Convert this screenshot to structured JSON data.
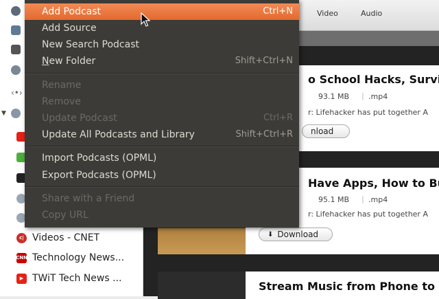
{
  "sidebar": {
    "items": [
      {
        "label": "Videos - CNET",
        "badge": "c|",
        "color": "#c8302a"
      },
      {
        "label": "Technology News...",
        "badge": "CNN",
        "color": "#cc0000"
      },
      {
        "label": "TWiT Tech News ...",
        "badge": "",
        "color": "#e62117"
      }
    ]
  },
  "toolbar": {
    "tabs": [
      "Video",
      "Audio"
    ]
  },
  "items": [
    {
      "title": "o School Hacks, Survive",
      "size": "93.1 MB",
      "format": ".mp4",
      "desc": "r: Lifehacker has put together A",
      "download": "nload"
    },
    {
      "title": "Have Apps, How to Buil",
      "size": "95.1 MB",
      "format": ".mp4",
      "desc": "r: Lifehacker has put together A",
      "download": "Download"
    },
    {
      "title": "Stream Music from Phone to"
    }
  ],
  "menu": {
    "add_podcast": {
      "label": "Add Podcast",
      "shortcut": "Ctrl+N"
    },
    "add_source": {
      "label": "Add Source"
    },
    "new_search_podcast": {
      "label": "New Search Podcast"
    },
    "new_folder": {
      "label": "New Folder",
      "mnemonic": "N",
      "rest": "ew Folder",
      "shortcut": "Shift+Ctrl+N"
    },
    "rename": {
      "label": "Rename"
    },
    "remove": {
      "label": "Remove"
    },
    "update_podcast": {
      "label": "Update Podcast",
      "shortcut": "Ctrl+R"
    },
    "update_all": {
      "label": "Update All Podcasts and Library",
      "shortcut": "Shift+Ctrl+R"
    },
    "import_opml": {
      "label": "Import Podcasts (OPML)"
    },
    "export_opml": {
      "label": "Export Podcasts (OPML)"
    },
    "share": {
      "label": "Share with a Friend"
    },
    "copy_url": {
      "label": "Copy URL"
    }
  },
  "colors": {
    "menu_bg": "#3c3b37",
    "menu_highlight": "#e8733c"
  }
}
